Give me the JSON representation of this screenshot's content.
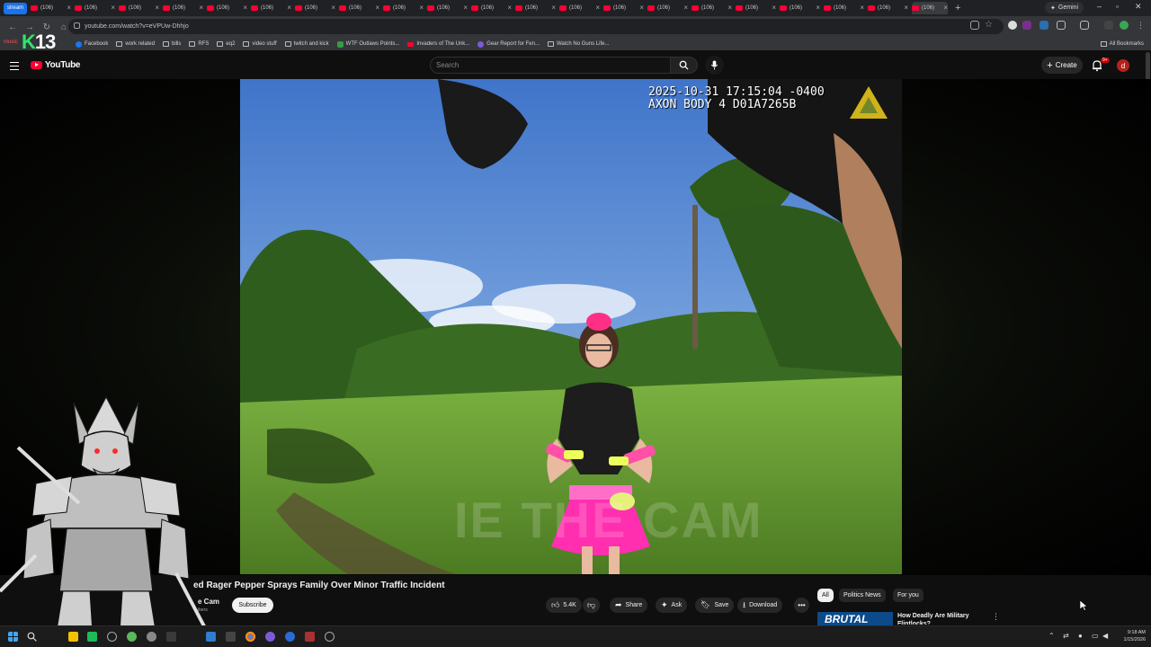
{
  "browser": {
    "first_tab_label": "stream",
    "tab_label": "(106)",
    "tab_count": 21,
    "gemini_label": "Gemini",
    "url": "youtube.com/watch?v=eVPUw-Dhhjo",
    "bookmarks": [
      {
        "label": "Facebook",
        "icon": "facebook-icon"
      },
      {
        "label": "work related",
        "icon": "folder-icon"
      },
      {
        "label": "bills",
        "icon": "folder-icon"
      },
      {
        "label": "RFS",
        "icon": "folder-icon"
      },
      {
        "label": "eq2",
        "icon": "folder-icon"
      },
      {
        "label": "video stuff",
        "icon": "folder-icon"
      },
      {
        "label": "twitch and kick",
        "icon": "folder-icon"
      },
      {
        "label": "WTF Outlaws Points...",
        "icon": "green-site-icon"
      },
      {
        "label": "Invaders of The Unk...",
        "icon": "youtube-icon"
      },
      {
        "label": "Gear Report for Fen...",
        "icon": "purple-site-icon"
      },
      {
        "label": "Watch No Guns Life...",
        "icon": "site-icon"
      }
    ],
    "all_bookmarks_label": "All Bookmarks",
    "music_label": "music"
  },
  "stream_overlay": {
    "badge_k": "K",
    "badge_num": "13"
  },
  "youtube": {
    "logo_text": "YouTube",
    "search_placeholder": "Search",
    "create_label": "Create",
    "notification_count": "9+",
    "avatar_letter": "d"
  },
  "video": {
    "timestamp_line1": "2025-10-31 17:15:04 -0400",
    "timestamp_line2": "AXON BODY 4 D01A7265B",
    "watermark": "IE THE CAM",
    "title": "ed Rager Pepper Sprays Family Over Minor Traffic Incident",
    "channel_name": "e Cam",
    "channel_subs": "ibers"
  },
  "actions": {
    "subscribe": "Subscribe",
    "likes": "5.4K",
    "share": "Share",
    "ask": "Ask",
    "save": "Save",
    "download": "Download",
    "more": "•••"
  },
  "chips": [
    "All",
    "Politics News",
    "For you"
  ],
  "recommendation": {
    "thumb_text": "BRUTAL",
    "title": "How Deadly Are Military Flintlocks?"
  },
  "taskbar": {
    "time": "9:18 AM",
    "date": "1/15/2026"
  },
  "colors": {
    "yt_red": "#ff0033",
    "bg": "#0f0f0f",
    "chip_bg": "#272727"
  }
}
